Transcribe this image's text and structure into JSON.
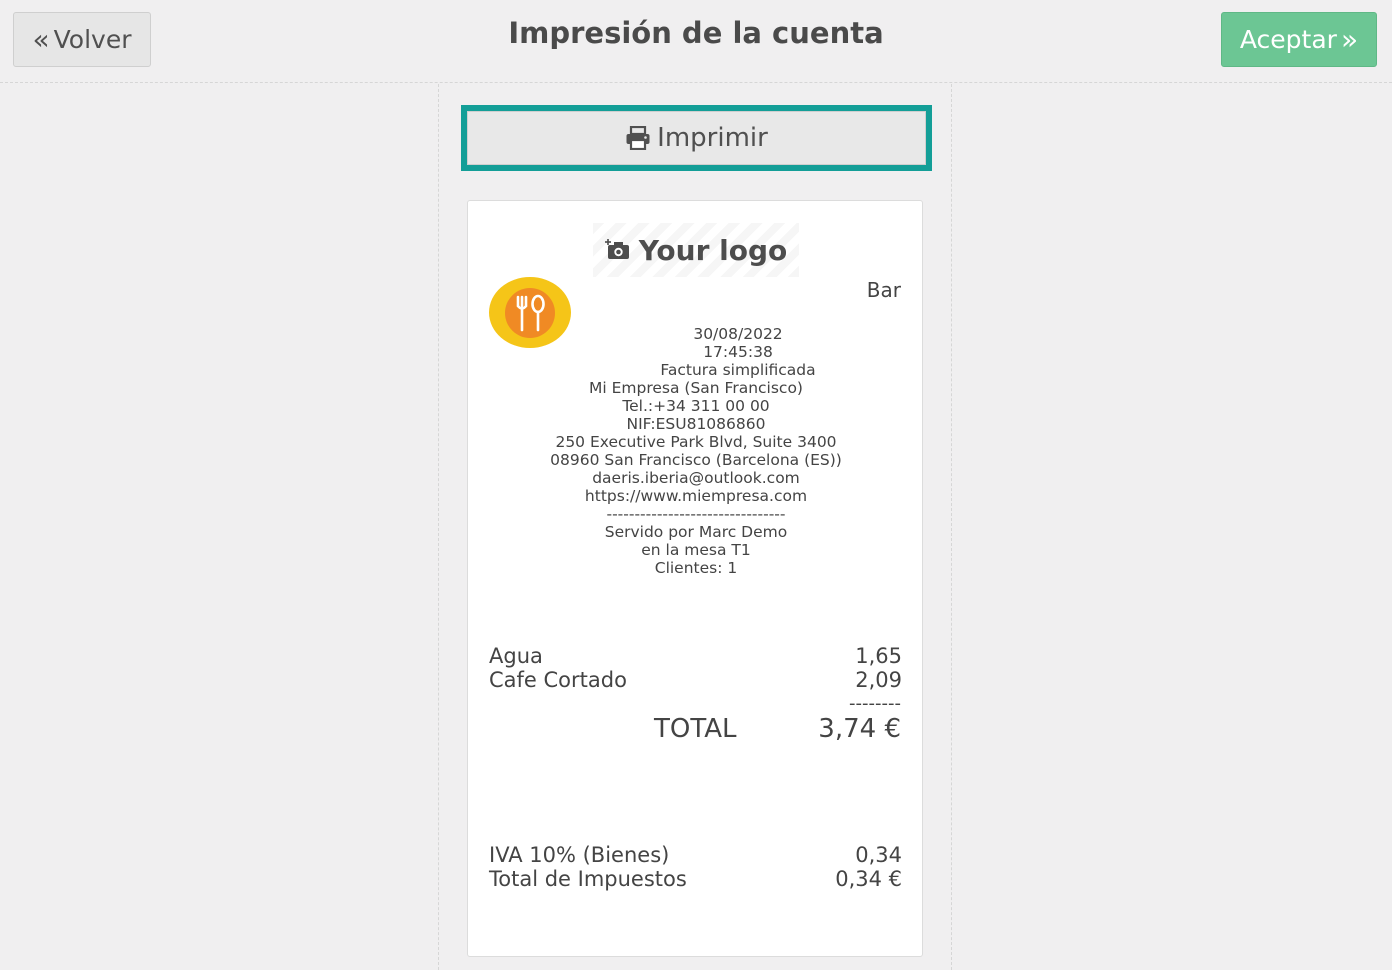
{
  "header": {
    "back_label": "Volver",
    "title": "Impresión de la cuenta",
    "accept_label": "Aceptar"
  },
  "print_button": {
    "label": "Imprimir"
  },
  "receipt": {
    "logo_text": "Your logo",
    "section": "Bar",
    "datetime": "30/08/2022 17:45:38",
    "doc_type": "Factura simplificada",
    "company_lines": [
      "Mi Empresa (San Francisco)",
      "Tel.:+34 311 00 00",
      "NIF:ESU81086860",
      "250 Executive Park Blvd, Suite 3400",
      "08960 San Francisco (Barcelona (ES))",
      "daeris.iberia@outlook.com",
      "https://www.miempresa.com",
      "--------------------------------",
      "Servido por Marc Demo",
      "en la mesa T1",
      "Clientes: 1"
    ],
    "items": [
      {
        "name": "Agua",
        "price": "1,65"
      },
      {
        "name": "Cafe Cortado",
        "price": "2,09"
      }
    ],
    "separator": "--------",
    "total_label": "TOTAL",
    "total_value": "3,74 €",
    "taxes": [
      {
        "name": "IVA 10% (Bienes)",
        "value": "0,34"
      },
      {
        "name": "Total de Impuestos",
        "value": "0,34 €"
      }
    ]
  },
  "colors": {
    "accept": "#6cc694",
    "print_focus": "#139e97",
    "badge_outer": "#f5c518",
    "badge_inner": "#f08a24"
  }
}
